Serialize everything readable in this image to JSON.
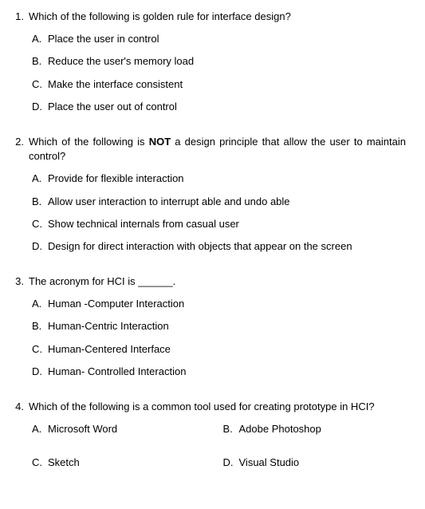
{
  "questions": [
    {
      "num": "1.",
      "text_before": "Which of the following is golden rule for interface design?",
      "bold": "",
      "text_after": "",
      "layout": "list",
      "options": [
        {
          "letter": "A.",
          "text": "Place the user in control"
        },
        {
          "letter": "B.",
          "text": "Reduce the user's memory load"
        },
        {
          "letter": "C.",
          "text": "Make the interface consistent"
        },
        {
          "letter": "D.",
          "text": "Place the user out of control"
        }
      ]
    },
    {
      "num": "2.",
      "text_before": "Which of the following is ",
      "bold": "NOT",
      "text_after": " a design principle that allow the user to maintain control?",
      "layout": "list",
      "options": [
        {
          "letter": "A.",
          "text": "Provide for flexible interaction"
        },
        {
          "letter": "B.",
          "text": "Allow user interaction to interrupt able and undo able"
        },
        {
          "letter": "C.",
          "text": "Show technical internals from casual user"
        },
        {
          "letter": "D.",
          "text": "Design for direct interaction with objects that appear on the screen"
        }
      ]
    },
    {
      "num": "3.",
      "text_before": "The acronym for HCI is ______.",
      "bold": "",
      "text_after": "",
      "layout": "list",
      "options": [
        {
          "letter": "A.",
          "text": "Human -Computer Interaction"
        },
        {
          "letter": "B.",
          "text": "Human-Centric Interaction"
        },
        {
          "letter": "C.",
          "text": "Human-Centered Interface"
        },
        {
          "letter": "D.",
          "text": "Human- Controlled Interaction"
        }
      ]
    },
    {
      "num": "4.",
      "text_before": "Which of the following is a common tool used for creating prototype in HCI?",
      "bold": "",
      "text_after": "",
      "layout": "grid",
      "options": [
        {
          "letter": "A.",
          "text": "Microsoft Word"
        },
        {
          "letter": "B.",
          "text": "Adobe Photoshop"
        },
        {
          "letter": "C.",
          "text": "Sketch"
        },
        {
          "letter": "D.",
          "text": "Visual Studio"
        }
      ]
    }
  ]
}
